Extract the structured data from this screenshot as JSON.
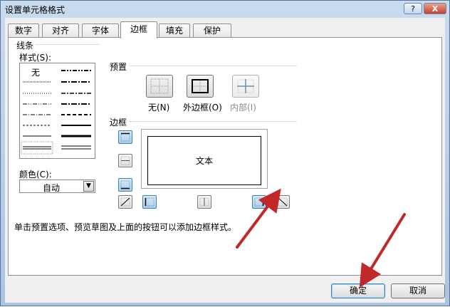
{
  "window": {
    "title": "设置单元格格式"
  },
  "titlebar": {
    "help_label": "?",
    "close_label": "X"
  },
  "tabs": [
    {
      "label": "数字"
    },
    {
      "label": "对齐"
    },
    {
      "label": "字体"
    },
    {
      "label": "边框"
    },
    {
      "label": "填充"
    },
    {
      "label": "保护"
    }
  ],
  "active_tab": "边框",
  "line": {
    "section_label": "线条",
    "style_label": "样式(S):",
    "none_label": "无",
    "color_label": "颜色(C):",
    "color_value": "自动"
  },
  "presets": {
    "section_label": "预置",
    "items": [
      {
        "label": "无(N)"
      },
      {
        "label": "外边框(O)"
      },
      {
        "label": "内部(I)"
      }
    ]
  },
  "border": {
    "section_label": "边框",
    "preview_text": "文本"
  },
  "hint": "单击预置选项、预览草图及上面的按钮可以添加边框样式。",
  "footer": {
    "ok_label": "确定",
    "cancel_label": "取消"
  },
  "colors": {
    "annotation_arrow": "#c0282a",
    "active_button": "#a8d0f0"
  }
}
